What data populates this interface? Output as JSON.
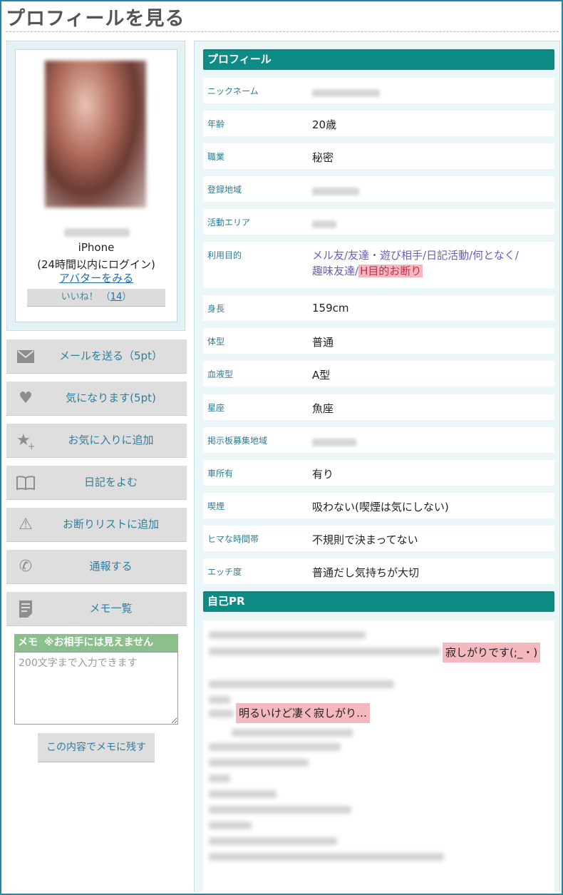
{
  "page_title": "プロフィールを見る",
  "left": {
    "device": "iPhone",
    "login_status": "(24時間以内にログイン)",
    "avatar_link": "アバターをみる",
    "like_label": "いいね！",
    "like_count": "14",
    "actions": [
      {
        "label": "メールを送る（5pt）",
        "icon": "mail-icon"
      },
      {
        "label": "気になります(5pt)",
        "icon": "heart-icon"
      },
      {
        "label": "お気に入りに追加",
        "icon": "star-add-icon"
      },
      {
        "label": "日記をよむ",
        "icon": "book-icon"
      },
      {
        "label": "お断りリストに追加",
        "icon": "warning-icon"
      },
      {
        "label": "通報する",
        "icon": "phone-icon"
      },
      {
        "label": "メモ一覧",
        "icon": "memo-icon"
      }
    ],
    "memo_title": "メモ",
    "memo_note": "※お相手には見えません",
    "memo_placeholder": "200文字まで入力できます",
    "memo_save": "この内容でメモに残す"
  },
  "profile": {
    "heading": "プロフィール",
    "rows": [
      {
        "label": "ニックネーム",
        "value": ""
      },
      {
        "label": "年齢",
        "value": "20歳"
      },
      {
        "label": "職業",
        "value": "秘密"
      },
      {
        "label": "登録地域",
        "value": ""
      },
      {
        "label": "活動エリア",
        "value": ""
      },
      {
        "label": "利用目的",
        "value": ""
      },
      {
        "label": "身長",
        "value": "159cm"
      },
      {
        "label": "体型",
        "value": "普通"
      },
      {
        "label": "血液型",
        "value": "A型"
      },
      {
        "label": "星座",
        "value": "魚座"
      },
      {
        "label": "掲示板募集地域",
        "value": ""
      },
      {
        "label": "車所有",
        "value": "有り"
      },
      {
        "label": "喫煙",
        "value": "吸わない(喫煙は気にしない)"
      },
      {
        "label": "ヒマな時間帯",
        "value": "不規則で決まってない"
      },
      {
        "label": "エッチ度",
        "value": "普通だし気持ちが大切"
      }
    ],
    "purpose_line1": "メル友/友達・遊び相手/日記活動/何となく/",
    "purpose_line2": "趣味友達/",
    "purpose_ng": "H目的お断り"
  },
  "self_pr": {
    "heading": "自己PR",
    "highlight1": "寂しがりです(;_・)",
    "highlight2": "明るいけど凄く寂しがり…"
  },
  "colors": {
    "accent": "#0f8b86",
    "link": "#1f6fa8",
    "ng_bg": "#f4b6c0",
    "memo_head": "#8bc08c"
  }
}
